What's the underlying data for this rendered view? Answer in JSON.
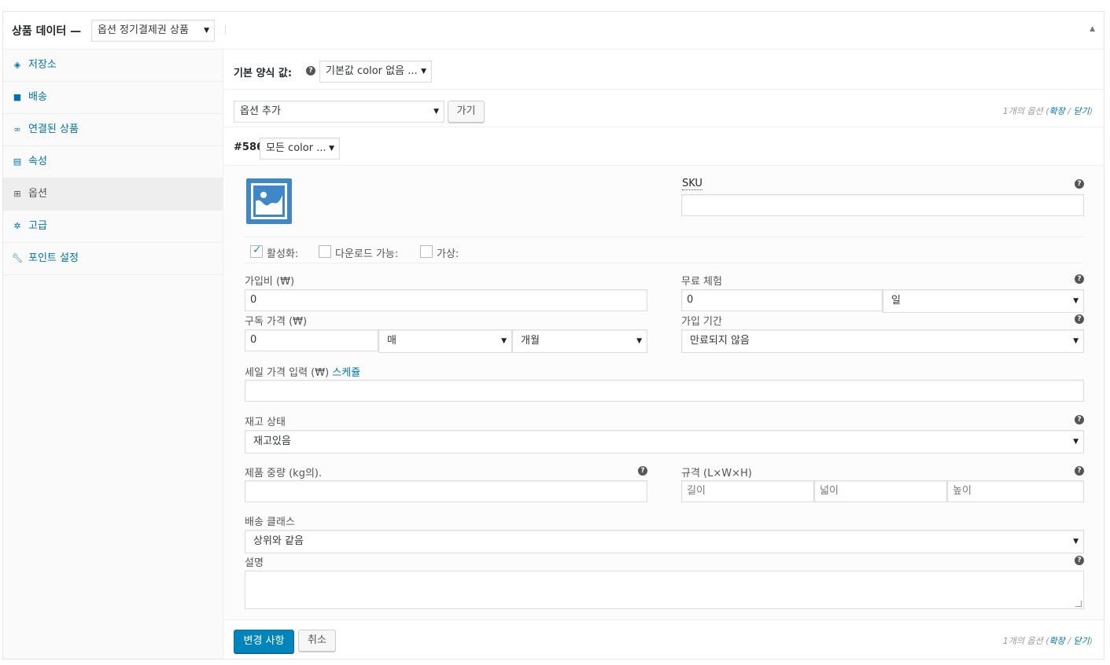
{
  "header": {
    "title": "상품 데이터 —",
    "product_type": "옵션 정기결제권 상품"
  },
  "tabs": [
    {
      "label": "저장소",
      "icon": "tag-icon"
    },
    {
      "label": "배송",
      "icon": "truck-icon"
    },
    {
      "label": "연결된 상품",
      "icon": "link-icon"
    },
    {
      "label": "속성",
      "icon": "list-icon"
    },
    {
      "label": "옵션",
      "icon": "grid-icon"
    },
    {
      "label": "고급",
      "icon": "gear-icon"
    },
    {
      "label": "포인트 설정",
      "icon": "wrench-icon"
    }
  ],
  "defaults": {
    "label": "기본 양식 값:",
    "value": "기본값 color 없음 ..."
  },
  "add_variation": {
    "select_value": "옵션 추가",
    "go_label": "가기"
  },
  "variations_info": {
    "count_text": "1개의 옵션 (",
    "expand": "확장",
    "sep": " / ",
    "close": "닫기",
    "end": ")"
  },
  "variation": {
    "id": "#586",
    "attribute_value": "모든 color ...",
    "sku_label": "SKU",
    "sku_value": "",
    "enabled_label": "활성화:",
    "downloadable_label": "다운로드 가능:",
    "virtual_label": "가상:",
    "signup_fee_label": "가입비 (₩)",
    "signup_fee_value": "0",
    "free_trial_label": "무료 체험",
    "free_trial_value": "0",
    "free_trial_period": "일",
    "price_label": "구독 가격 (₩)",
    "price_value": "0",
    "price_interval": "매",
    "price_period": "개월",
    "length_label": "가입 기간",
    "length_value": "만료되지 않음",
    "sale_label": "세일 가격 입력 (₩)",
    "sale_schedule": "스케쥴",
    "stock_label": "재고 상태",
    "stock_value": "재고있음",
    "weight_label": "제품 중량 (kg의).",
    "dimensions_label": "규격 (L×W×H)",
    "length_ph": "길이",
    "width_ph": "넓이",
    "height_ph": "높이",
    "shipping_class_label": "배송 클래스",
    "shipping_class_value": "상위와 같음",
    "description_label": "설명"
  },
  "footer": {
    "save_label": "변경 사항",
    "cancel_label": "취소"
  },
  "colors": {
    "link": "#0073aa",
    "primary_button": "#0085ba",
    "thumbnail": "#3f87c7"
  }
}
